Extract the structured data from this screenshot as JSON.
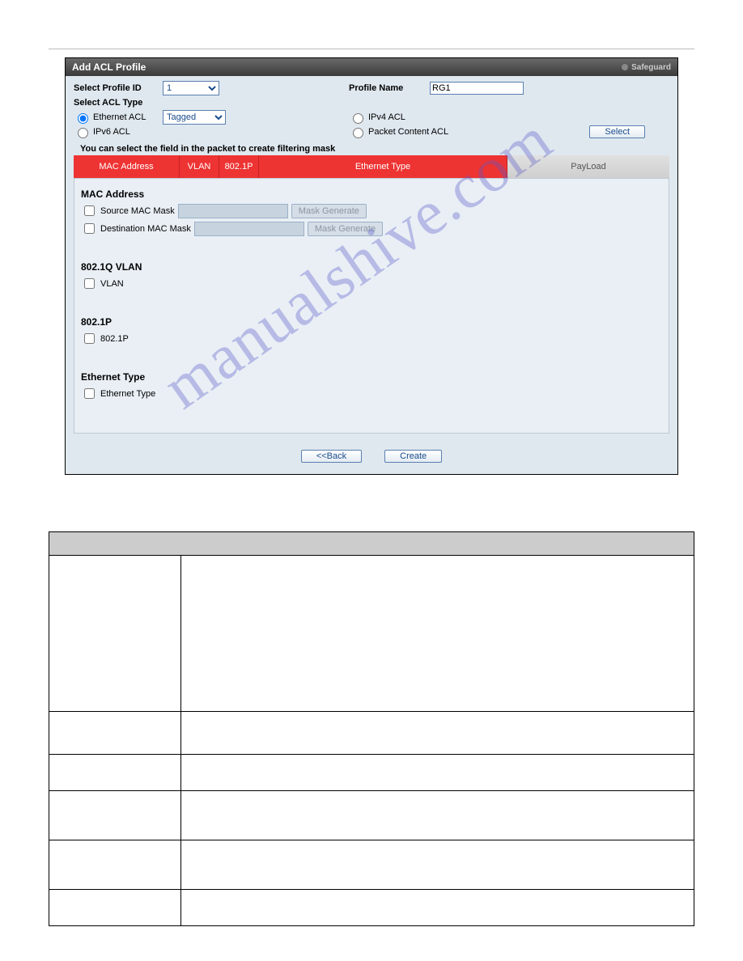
{
  "window": {
    "title": "Add ACL Profile",
    "safeguard": "Safeguard"
  },
  "form": {
    "profile_id_label": "Select Profile ID",
    "profile_id_options": [
      "1"
    ],
    "profile_name_label": "Profile Name",
    "profile_name_value": "RG1",
    "acl_type_label": "Select ACL Type",
    "eth_acl_label": "Ethernet ACL",
    "tagged_options": [
      "Tagged"
    ],
    "ipv6_label": "IPv6 ACL",
    "ipv4_label": "IPv4 ACL",
    "packet_content_label": "Packet Content ACL",
    "select_btn": "Select",
    "hint": "You can select the field in the packet to create filtering mask"
  },
  "tabs": {
    "mac": "MAC Address",
    "vlan": "VLAN",
    "p8021": "802.1P",
    "eth": "Ethernet Type",
    "payload": "PayLoad"
  },
  "sections": {
    "mac_title": "MAC Address",
    "src_mac_label": "Source MAC Mask",
    "dst_mac_label": "Destination MAC Mask",
    "mask_gen_btn": "Mask Generate",
    "vlan_title": "802.1Q VLAN",
    "vlan_chk": "VLAN",
    "p8021_title": "802.1P",
    "p8021_chk": "802.1P",
    "eth_title": "Ethernet Type",
    "eth_chk": "Ethernet Type"
  },
  "buttons": {
    "back": "<<Back",
    "create": "Create"
  },
  "watermark": "manualshive.com"
}
